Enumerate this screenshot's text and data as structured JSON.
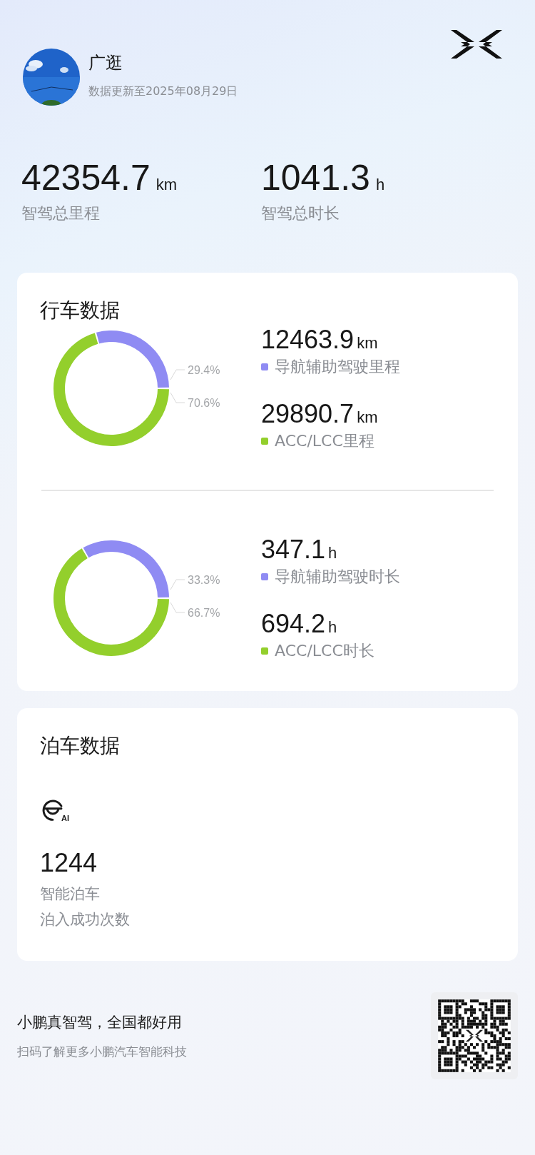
{
  "profile": {
    "name": "广逛",
    "updated": "数据更新至2025年08月29日"
  },
  "totals": [
    {
      "value": "42354.7",
      "unit": "km",
      "label": "智驾总里程"
    },
    {
      "value": "1041.3",
      "unit": "h",
      "label": "智驾总时长"
    }
  ],
  "driving": {
    "title": "行车数据",
    "groups": [
      {
        "chart_data": {
          "type": "donut",
          "values": [
            29.4,
            70.6
          ],
          "value_labels": [
            "29.4%",
            "70.6%"
          ]
        },
        "items": [
          {
            "value": "12463.9",
            "unit": "km",
            "label": "导航辅助驾驶里程",
            "color": "#8f8bf3"
          },
          {
            "value": "29890.7",
            "unit": "km",
            "label": "ACC/LCC里程",
            "color": "#93cf2c"
          }
        ]
      },
      {
        "chart_data": {
          "type": "donut",
          "values": [
            33.3,
            66.7
          ],
          "value_labels": [
            "33.3%",
            "66.7%"
          ]
        },
        "items": [
          {
            "value": "347.1",
            "unit": "h",
            "label": "导航辅助驾驶时长",
            "color": "#8f8bf3"
          },
          {
            "value": "694.2",
            "unit": "h",
            "label": "ACC/LCC时长",
            "color": "#93cf2c"
          }
        ]
      }
    ]
  },
  "parking": {
    "title": "泊车数据",
    "icon_badge": "AI",
    "value": "1244",
    "label": "智能泊车",
    "sublabel": "泊入成功次数"
  },
  "footer": {
    "slogan": "小鹏真智驾，全国都好用",
    "caption": "扫码了解更多小鹏汽车智能科技"
  }
}
